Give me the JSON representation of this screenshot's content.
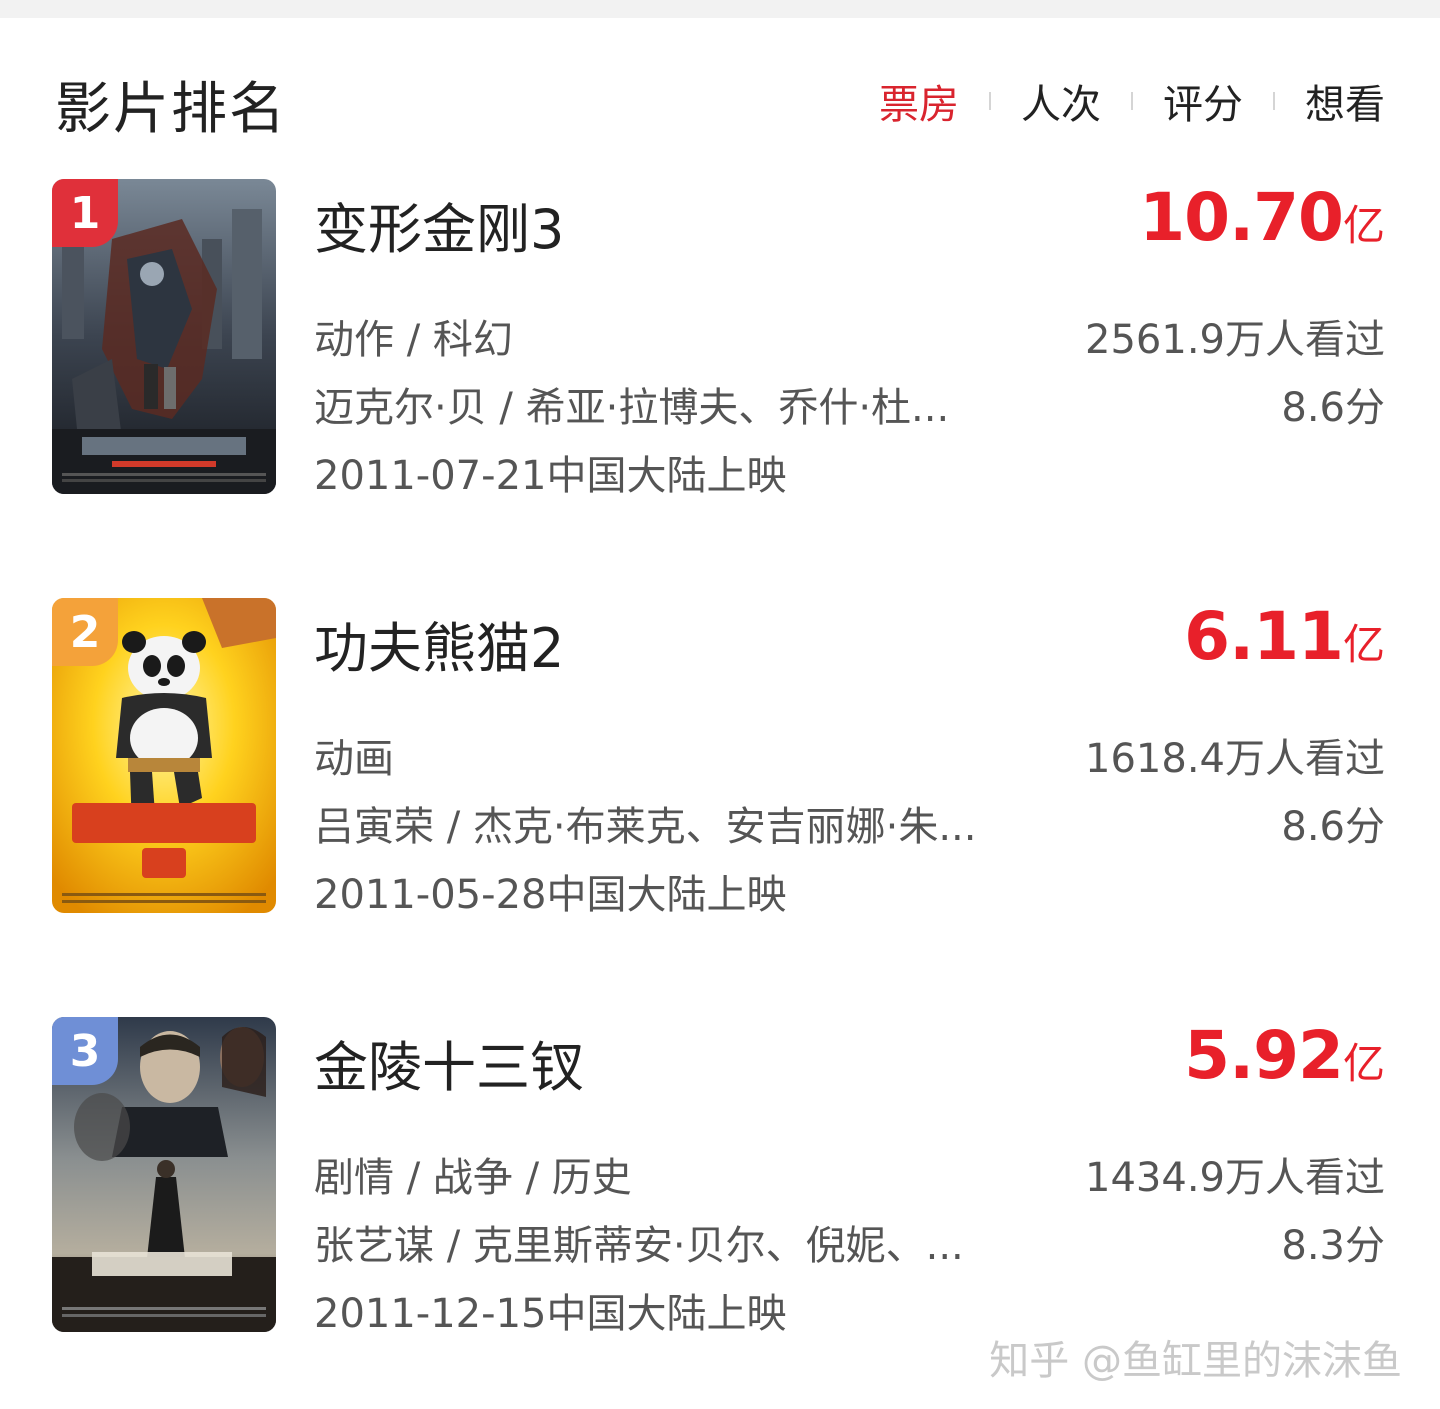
{
  "header": {
    "title": "影片排名",
    "tabs": [
      {
        "label": "票房",
        "active": true
      },
      {
        "label": "人次",
        "active": false
      },
      {
        "label": "评分",
        "active": false
      },
      {
        "label": "想看",
        "active": false
      }
    ]
  },
  "movies": [
    {
      "rank": "1",
      "name": "变形金刚3",
      "box_office": "10.70",
      "box_office_unit": "亿",
      "genre": "动作 / 科幻",
      "crew": "迈克尔·贝 / 希亚·拉博夫、乔什·杜...",
      "release": "2011-07-21中国大陆上映",
      "viewers": "2561.9万人看过",
      "score": "8.6分",
      "badge_color": "#e0303a",
      "poster_icon": "transformers-poster"
    },
    {
      "rank": "2",
      "name": "功夫熊猫2",
      "box_office": "6.11",
      "box_office_unit": "亿",
      "genre": "动画",
      "crew": "吕寅荣 / 杰克·布莱克、安吉丽娜·朱...",
      "release": "2011-05-28中国大陆上映",
      "viewers": "1618.4万人看过",
      "score": "8.6分",
      "badge_color": "#f4a23a",
      "poster_icon": "kungfu-panda-poster"
    },
    {
      "rank": "3",
      "name": "金陵十三钗",
      "box_office": "5.92",
      "box_office_unit": "亿",
      "genre": "剧情 / 战争 / 历史",
      "crew": "张艺谋 / 克里斯蒂安·贝尔、倪妮、...",
      "release": "2011-12-15中国大陆上映",
      "viewers": "1434.9万人看过",
      "score": "8.3分",
      "badge_color": "#6f8fd6",
      "poster_icon": "flowers-of-war-poster"
    }
  ],
  "watermark": "知乎 @鱼缸里的沫沫鱼",
  "colors": {
    "accent": "#d9242e",
    "box_office": "#e8202a"
  }
}
